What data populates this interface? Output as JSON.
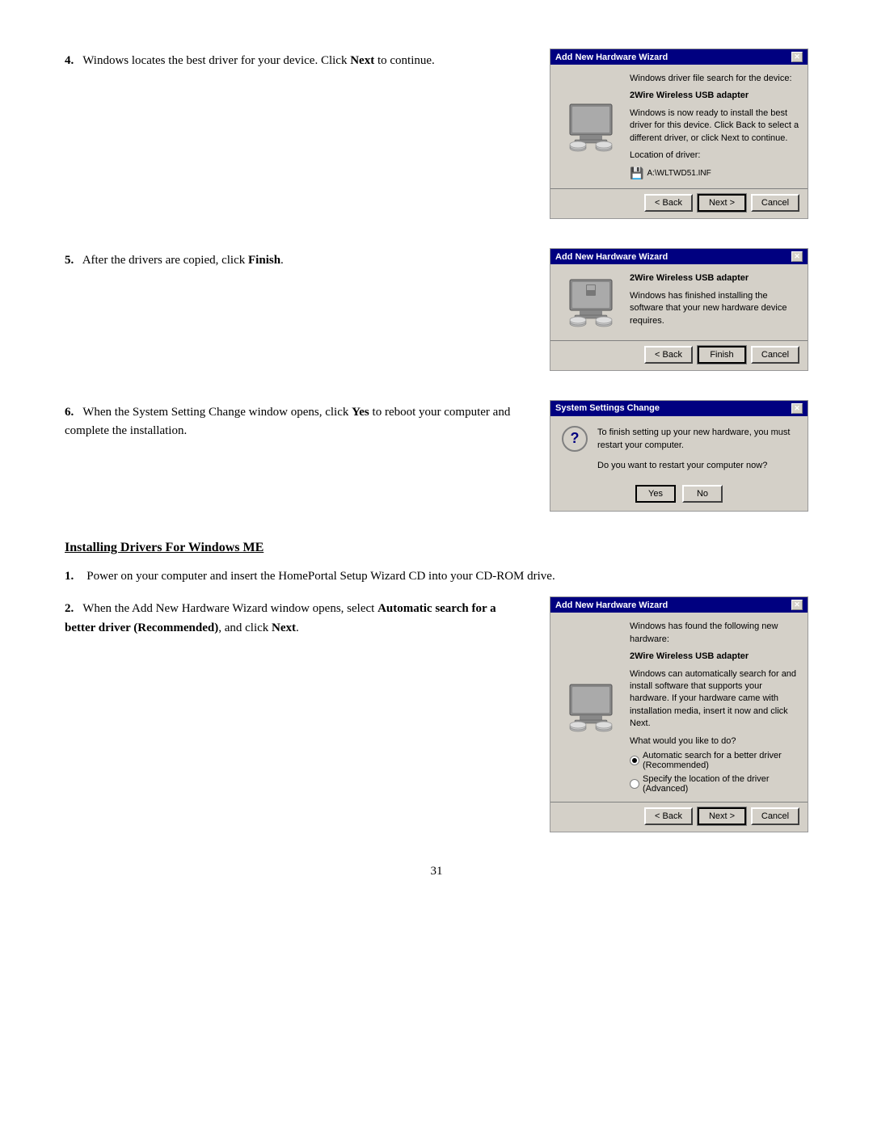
{
  "page": {
    "page_number": "31"
  },
  "steps": {
    "step4": {
      "number": "4.",
      "text_before": "Windows locates the best driver for your device. Click ",
      "bold_text": "Next",
      "text_after": " to continue."
    },
    "step5": {
      "number": "5.",
      "text_before": "After the drivers are copied, click ",
      "bold_text": "Finish",
      "text_after": "."
    },
    "step6": {
      "number": "6.",
      "text_before": "When the System Setting Change window opens, click ",
      "bold_text1": "Yes",
      "text_middle": " to reboot your computer and complete the installation."
    }
  },
  "section_heading": "Installing Drivers For Windows ME",
  "me_steps": {
    "step1": {
      "number": "1.",
      "text": "Power on your computer and insert the HomePortal Setup Wizard CD into your CD-ROM drive."
    },
    "step2": {
      "number": "2.",
      "text_before": "When the Add New Hardware Wizard window opens, select ",
      "bold1": "Automatic search for a better driver (Recommended)",
      "text_middle": ", and click ",
      "bold2": "Next",
      "text_after": "."
    }
  },
  "dialog_step4": {
    "title": "Add New Hardware Wizard",
    "close_btn": "✕",
    "text1": "Windows driver file search for the device:",
    "device_name": "2Wire Wireless USB adapter",
    "text2": "Windows is now ready to install the best driver for this device. Click Back to select a different driver, or click Next to continue.",
    "location_label": "Location of driver:",
    "location_value": "A:\\WLTWD51.INF",
    "buttons": [
      "< Back",
      "Next >",
      "Cancel"
    ]
  },
  "dialog_step5": {
    "title": "Add New Hardware Wizard",
    "close_btn": "✕",
    "device_name": "2Wire Wireless USB adapter",
    "text": "Windows has finished installing the software that your new hardware device requires.",
    "buttons": [
      "< Back",
      "Finish",
      "Cancel"
    ]
  },
  "dialog_step6": {
    "title": "System Settings Change",
    "close_btn": "✕",
    "question_icon": "?",
    "text1": "To finish setting up your new hardware, you must restart your computer.",
    "text2": "Do you want to restart your computer now?",
    "buttons": [
      "Yes",
      "No"
    ]
  },
  "dialog_me_step2": {
    "title": "Add New Hardware Wizard",
    "close_btn": "✕",
    "text1": "Windows has found the following new hardware:",
    "device_name": "2Wire Wireless USB adapter",
    "text2": "Windows can automatically search for and install software that supports your hardware. If your hardware came with installation media, insert it now and click Next.",
    "question": "What would you like to do?",
    "radio1": "Automatic search for a better driver (Recommended)",
    "radio2": "Specify the location of the driver (Advanced)",
    "radio1_selected": true,
    "buttons": [
      "< Back",
      "Next >",
      "Cancel"
    ]
  }
}
